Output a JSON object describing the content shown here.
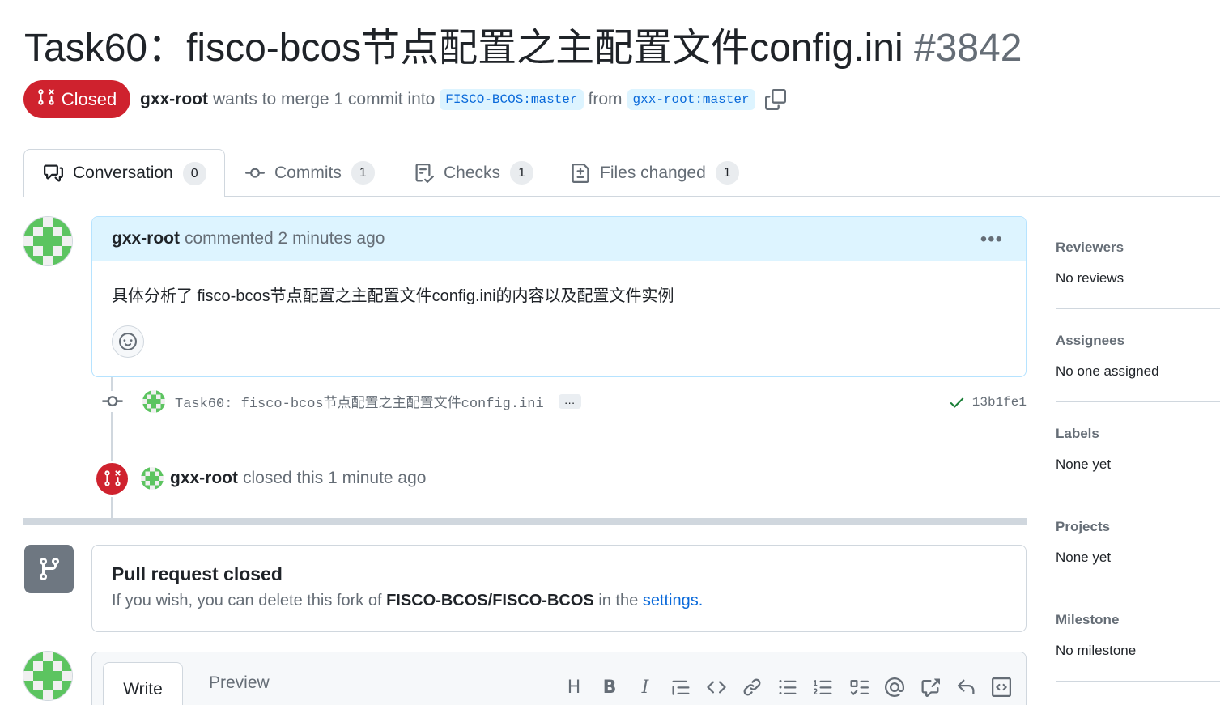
{
  "pr": {
    "title": "Task60：fisco-bcos节点配置之主配置文件config.ini",
    "number": "#3842",
    "state": "Closed",
    "author": "gxx-root",
    "merge_text": "wants to merge 1 commit into",
    "base_branch": "FISCO-BCOS:master",
    "from_text": "from",
    "head_branch": "gxx-root:master"
  },
  "tabs": [
    {
      "label": "Conversation",
      "count": "0",
      "icon": "comment-discussion-icon"
    },
    {
      "label": "Commits",
      "count": "1",
      "icon": "git-commit-icon"
    },
    {
      "label": "Checks",
      "count": "1",
      "icon": "checklist-icon"
    },
    {
      "label": "Files changed",
      "count": "1",
      "icon": "file-diff-icon"
    }
  ],
  "comment": {
    "author": "gxx-root",
    "meta": "commented 2 minutes ago",
    "body": "具体分析了 fisco-bcos节点配置之主配置文件config.ini的内容以及配置文件实例"
  },
  "commit": {
    "message": "Task60: fisco-bcos节点配置之主配置文件config.ini",
    "expand": "…",
    "sha": "13b1fe1"
  },
  "closed_event": {
    "author": "gxx-root",
    "text": "closed this 1 minute ago"
  },
  "merge_box": {
    "title": "Pull request closed",
    "text_prefix": "If you wish, you can delete this fork of",
    "repo": "FISCO-BCOS/FISCO-BCOS",
    "text_mid": "in the",
    "link": "settings",
    "text_suffix": "."
  },
  "composer": {
    "write_tab": "Write",
    "preview_tab": "Preview",
    "heading_tool": "H",
    "bold_tool": "B",
    "italic_tool": "I"
  },
  "sidebar": [
    {
      "heading": "Reviewers",
      "value": "No reviews"
    },
    {
      "heading": "Assignees",
      "value": "No one assigned"
    },
    {
      "heading": "Labels",
      "value": "None yet"
    },
    {
      "heading": "Projects",
      "value": "None yet"
    },
    {
      "heading": "Milestone",
      "value": "No milestone"
    }
  ],
  "colors": {
    "closed": "#cf222e",
    "link": "#0969da",
    "header_bg": "#ddf4ff",
    "avatar_green": "#5cc460"
  }
}
